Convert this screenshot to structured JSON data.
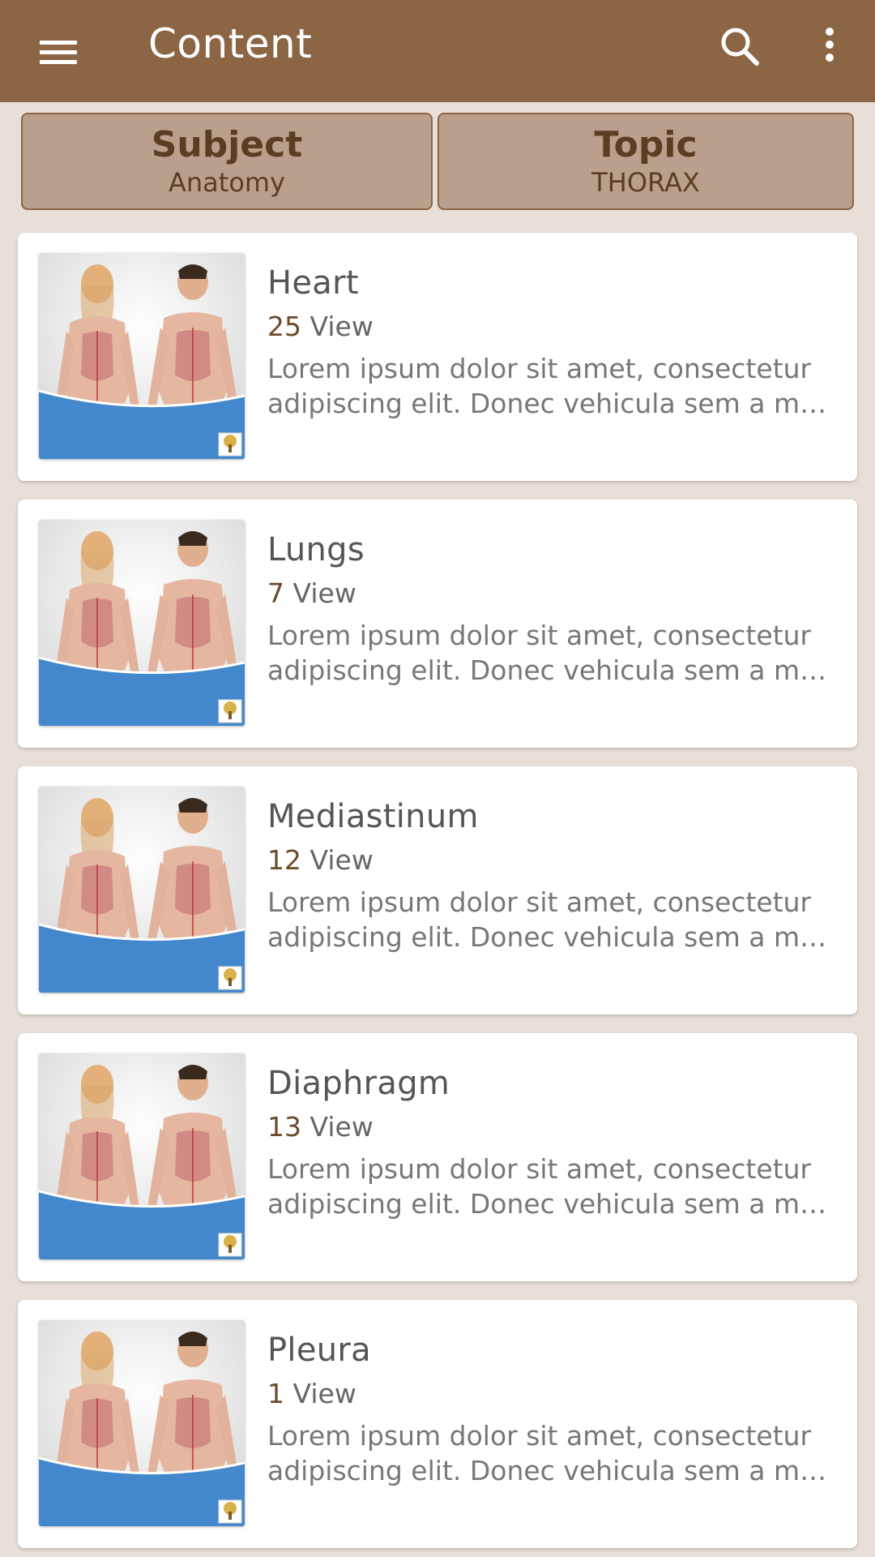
{
  "app_bar": {
    "title": "Content",
    "menu_icon": "hamburger-menu-icon",
    "search_icon": "search-icon",
    "more_icon": "more-vertical-icon",
    "background": "#8b6544"
  },
  "selectors": {
    "subject": {
      "label": "Subject",
      "value": "Anatomy"
    },
    "topic": {
      "label": "Topic",
      "value": "THORAX"
    }
  },
  "items": [
    {
      "title": "Heart",
      "count": "25",
      "views_label": "View",
      "description": "Lorem ipsum dolor sit amet, consectetur adipiscing elit. Donec vehicula sem a m…"
    },
    {
      "title": "Lungs",
      "count": "7",
      "views_label": "View",
      "description": "Lorem ipsum dolor sit amet, consectetur adipiscing elit. Donec vehicula sem a m…"
    },
    {
      "title": "Mediastinum",
      "count": "12",
      "views_label": "View",
      "description": "Lorem ipsum dolor sit amet, consectetur adipiscing elit. Donec vehicula sem a m…"
    },
    {
      "title": "Diaphragm",
      "count": "13",
      "views_label": "View",
      "description": "Lorem ipsum dolor sit amet, consectetur adipiscing elit. Donec vehicula sem a m…"
    },
    {
      "title": "Pleura",
      "count": "1",
      "views_label": "View",
      "description": "Lorem ipsum dolor sit amet, consectetur adipiscing elit. Donec vehicula sem a m…"
    }
  ],
  "colors": {
    "accent": "#8b6544",
    "selector_bg": "#b9a08d",
    "thumb_blue": "#4388cc",
    "page_bg": "#e8e0d8"
  }
}
